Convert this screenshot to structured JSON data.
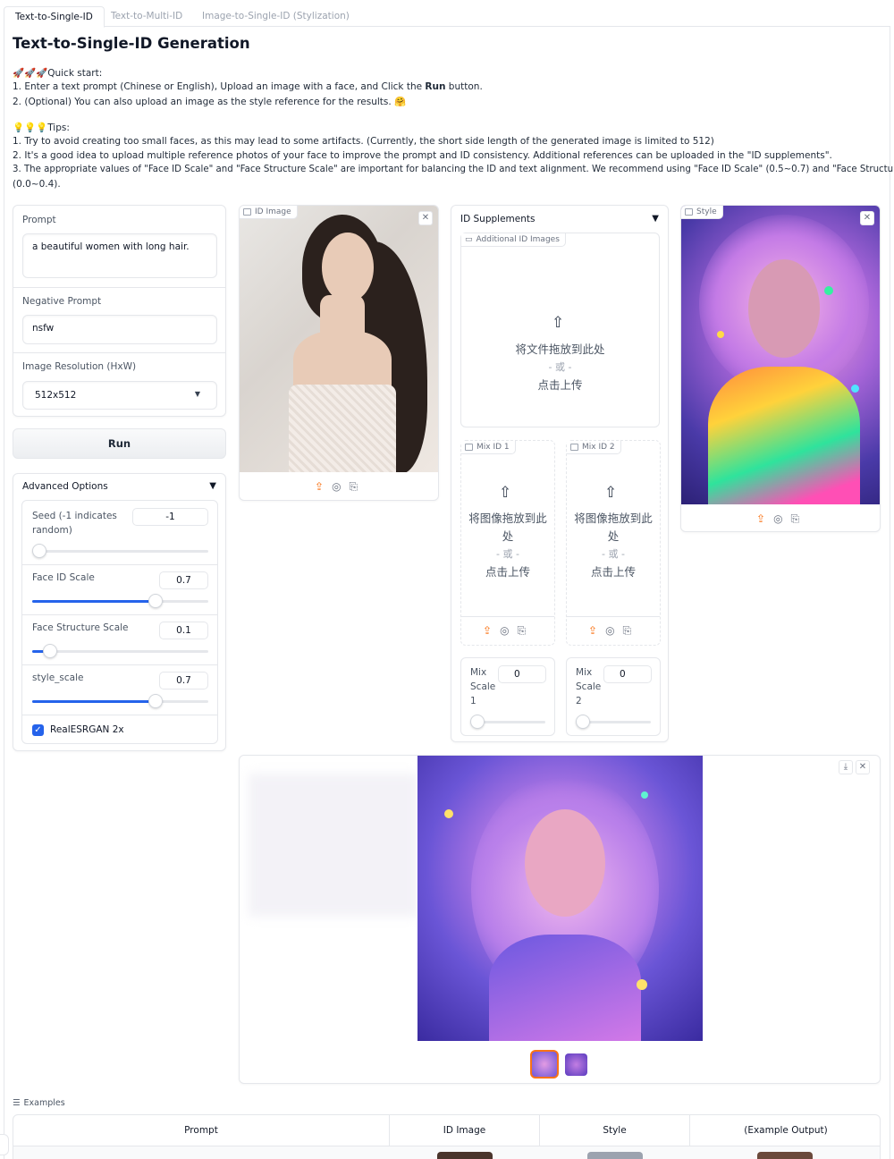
{
  "tabs": [
    "Text-to-Single-ID",
    "Text-to-Multi-ID",
    "Image-to-Single-ID (Stylization)"
  ],
  "page_title": "Text-to-Single-ID Generation",
  "quick_start": {
    "heading": "🚀🚀🚀Quick start:",
    "line1_prefix": "1. Enter a text prompt (Chinese or English), Upload an image with a face, and Click the ",
    "line1_bold": "Run",
    "line1_suffix": " button.",
    "line2": "2. (Optional) You can also upload an image as the style reference for the results. 🤗"
  },
  "tips": {
    "heading": "💡💡💡Tips:",
    "line1": "1. Try to avoid creating too small faces, as this may lead to some artifacts. (Currently, the short side length of the generated image is limited to 512)",
    "line2": "2. It's a good idea to upload multiple reference photos of your face to improve the prompt and ID consistency. Additional references can be uploaded in the \"ID supplements\".",
    "line3a": "3. The appropriate values of \"Face ID Scale\" and \"Face Structure Scale\" are important for balancing the ID and text alignment. We recommend using \"Face ID Scale\" (0.5~0.7) and \"Face Structure Scale\"",
    "line3b": "(0.0~0.4)."
  },
  "form": {
    "prompt_label": "Prompt",
    "prompt_value": "a beautiful women with long hair.",
    "negative_label": "Negative Prompt",
    "negative_value": "nsfw",
    "resolution_label": "Image Resolution (HxW)",
    "resolution_value": "512x512",
    "run_label": "Run"
  },
  "advanced": {
    "title": "Advanced Options",
    "seed_label_1": "Seed (-1 indicates",
    "seed_label_2": "random)",
    "seed_value": "-1",
    "face_id_label": "Face ID Scale",
    "face_id_value": "0.7",
    "face_id_fraction": 0.7,
    "face_structure_label": "Face Structure Scale",
    "face_structure_value": "0.1",
    "face_structure_fraction": 0.1,
    "style_scale_label": "style_scale",
    "style_scale_value": "0.7",
    "style_scale_fraction": 0.7,
    "esrgan_label": "RealESRGAN 2x",
    "esrgan_checked": true
  },
  "id_image": {
    "label": "ID Image"
  },
  "supplements": {
    "title": "ID Supplements",
    "additional_label": "Additional ID Images",
    "drop_line1": "将文件拖放到此处",
    "drop_or": "- 或 -",
    "drop_line2": "点击上传",
    "mix1_label": "Mix ID 1",
    "mix2_label": "Mix ID 2",
    "mix_drop_line1a": "将图像拖放到此",
    "mix_drop_line1b": "处",
    "mix_or": "- 或 -",
    "mix_drop_line2": "点击上传",
    "mix_scale1": [
      "Mix",
      "Scale",
      "1"
    ],
    "mix_scale2": [
      "Mix",
      "Scale",
      "2"
    ],
    "mix_scale1_value": "0",
    "mix_scale2_value": "0"
  },
  "style": {
    "label": "Style"
  },
  "examples": {
    "label": "Examples",
    "columns": [
      "Prompt",
      "ID Image",
      "Style",
      "(Example Output)"
    ]
  },
  "colors": {
    "accent": "#2563eb",
    "upload": "#f97316"
  }
}
